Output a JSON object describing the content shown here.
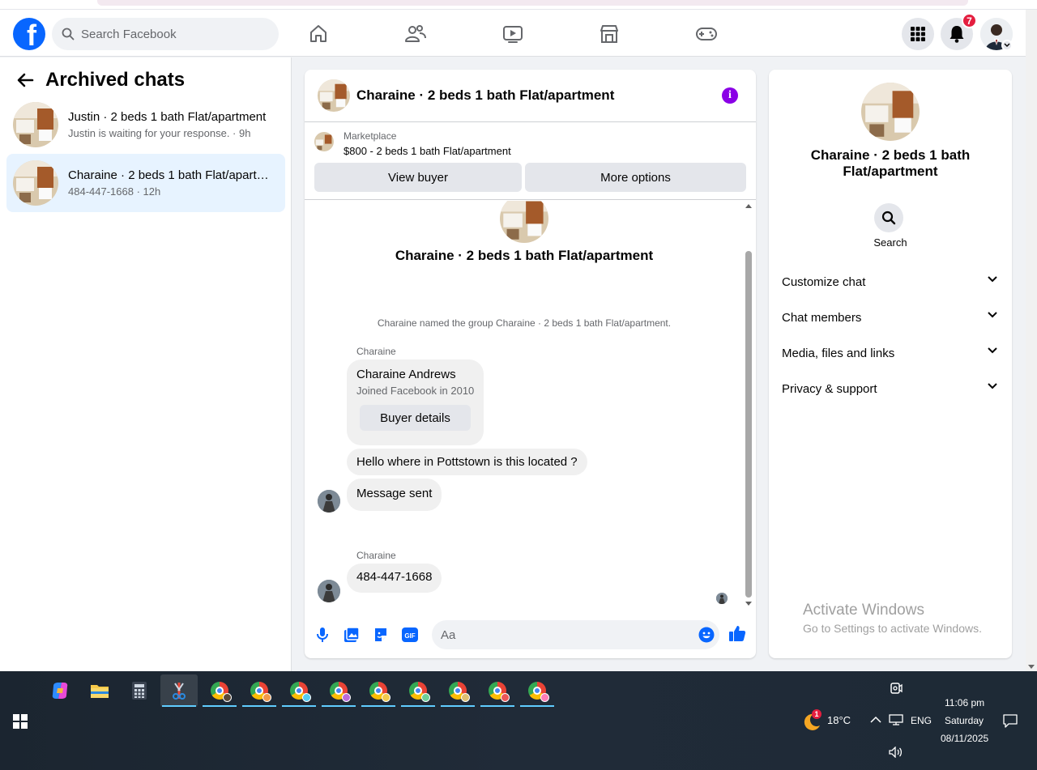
{
  "topnav": {
    "logo_letter": "f",
    "search_placeholder": "Search Facebook",
    "notifications_count": "7"
  },
  "left": {
    "title": "Archived chats",
    "chats": [
      {
        "title": "Justin · 2 beds 1 bath Flat/apartment",
        "subtitle": "Justin is waiting for your response. · 9h",
        "active": false
      },
      {
        "title": "Charaine · 2 beds 1 bath Flat/apartment",
        "subtitle": "484-447-1668 · 12h",
        "active": true
      }
    ]
  },
  "conversation": {
    "title": "Charaine · 2 beds 1 bath Flat/apartment",
    "marketplace_label": "Marketplace",
    "listing": "$800 - 2 beds 1 bath Flat/apartment",
    "view_buyer": "View buyer",
    "more_options": "More options",
    "intro_title": "Charaine · 2 beds 1 bath Flat/apartment",
    "system_message": "Charaine named the group Charaine · 2 beds 1 bath Flat/apartment.",
    "sender1": "Charaine",
    "profile_name": "Charaine Andrews",
    "profile_joined": "Joined Facebook in 2010",
    "buyer_details": "Buyer details",
    "msg1": "Hello where in Pottstown is this located ?",
    "msg2": "Message sent",
    "sender2": "Charaine",
    "msg3": "484-447-1668",
    "composer_placeholder": "Aa",
    "gif_label": "GIF"
  },
  "right": {
    "title": "Charaine · 2 beds 1 bath Flat/apartment",
    "search_label": "Search",
    "sections": [
      "Customize chat",
      "Chat members",
      "Media, files and links",
      "Privacy & support"
    ]
  },
  "watermark": {
    "line1": "Activate Windows",
    "line2": "Go to Settings to activate Windows."
  },
  "taskbar": {
    "weather_temp": "18°C",
    "weather_badge": "1",
    "lang": "ENG",
    "time": "11:06 pm",
    "day": "Saturday",
    "date": "08/11/2025"
  },
  "colors": {
    "brand": "#0866ff",
    "active_chat": "#e7f3ff",
    "info_purple": "#8a00e6",
    "badge_red": "#e41e3f"
  }
}
